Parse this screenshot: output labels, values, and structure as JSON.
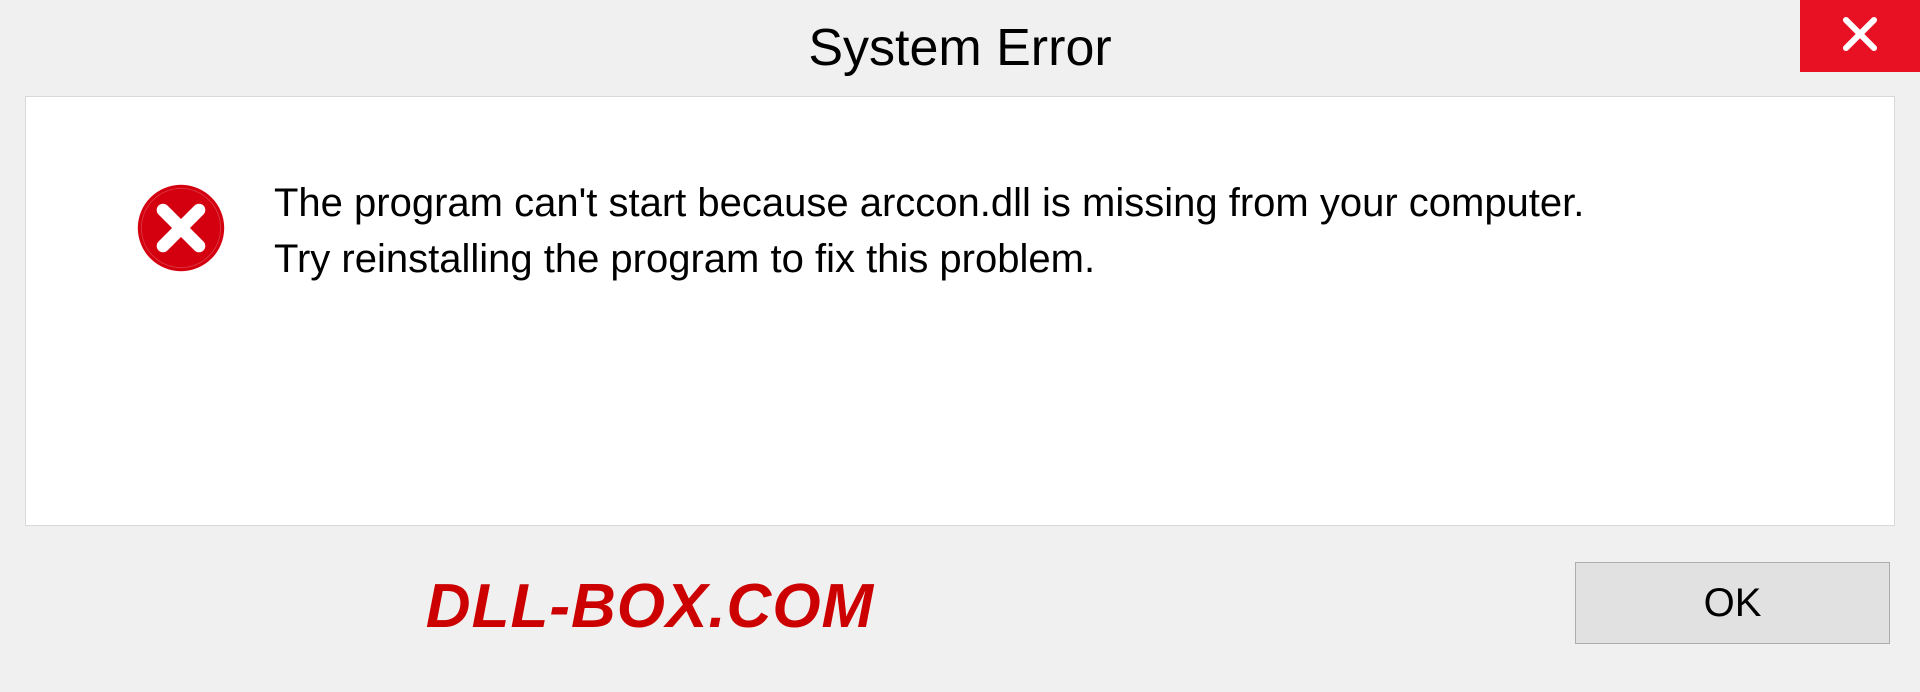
{
  "dialog": {
    "title": "System Error",
    "message_line1": "The program can't start because arccon.dll is missing from your computer.",
    "message_line2": "Try reinstalling the program to fix this problem.",
    "ok_label": "OK"
  },
  "brand": {
    "text": "DLL-BOX.COM"
  },
  "colors": {
    "close_bg": "#e81123",
    "error_red": "#cc0000"
  }
}
